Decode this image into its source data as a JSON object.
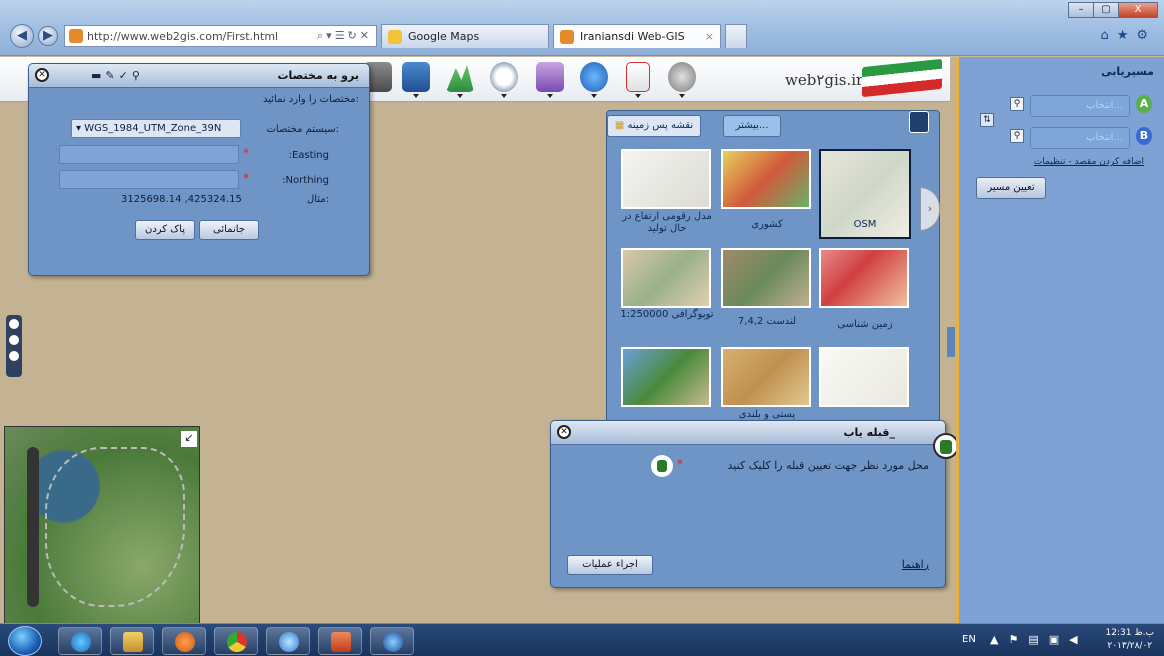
{
  "browser": {
    "url": "http://www.web2gis.com/First.html",
    "tab1": "Google Maps",
    "tab2": "Iraniansdi Web-GIS",
    "win_min": "–",
    "win_max": "▢",
    "win_close": "X"
  },
  "header": {
    "logo_text": "web۲gis.ir"
  },
  "coord_panel": {
    "title": "برو به مختصات",
    "subtitle": "مختصات را وارد نمائید:",
    "system_label": "سیستم مختصات:",
    "system_value": "WGS_1984_UTM_Zone_39N",
    "easting_label": ":Easting",
    "northing_label": ":Northing",
    "example_label": "مثال:",
    "example_value": "3125698.14 ,425324.15",
    "clear_button": "پاک کردن",
    "locate_button": "جانمائی"
  },
  "basemap_panel": {
    "tab_basemap": "نقشه پس زمینه",
    "tab_back": "بیشتر...",
    "thumbs": [
      {
        "label": "OSM"
      },
      {
        "label": "کشوری"
      },
      {
        "label": "مدل رقومی ارتفاع در حال تولید"
      },
      {
        "label": "زمین شناسی"
      },
      {
        "label": "لندست 7,4,2"
      },
      {
        "label": "توپوگرافی 1:250000"
      },
      {
        "label": ""
      },
      {
        "label": "پستی و بلندی"
      },
      {
        "label": ""
      }
    ]
  },
  "qibla_panel": {
    "title": "قبله یاب_",
    "instruction": "محل مورد نظر جهت تعیین قبله را کلیک کنید",
    "run_button": "اجراء عملیات",
    "help_link": "راهنما"
  },
  "sidebar": {
    "title": "مسیریابی",
    "start_placeholder": "انتخاب...",
    "end_placeholder": "انتخاب...",
    "pin_a": "A",
    "pin_b": "B",
    "add_link": "اضافه کردن مقصد - تنظیمات",
    "route_button": "تعیین مسیر"
  },
  "taskbar": {
    "lang": "EN",
    "time": "12:31 ب.ظ",
    "date": "۲۰۱۳/۲۸/۰۲"
  },
  "colors": {
    "panel_bg": "#6f94c6",
    "map_bg": "#c4b393",
    "accent": "#e8b040"
  }
}
